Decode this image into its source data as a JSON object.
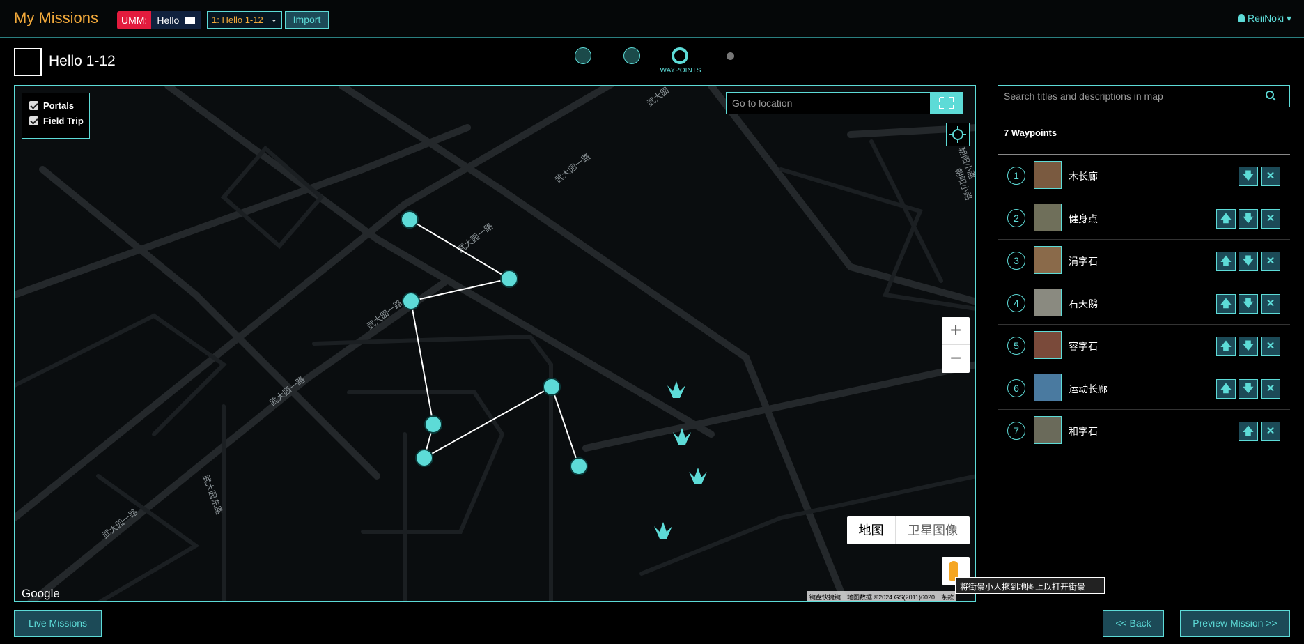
{
  "header": {
    "brand": "My Missions",
    "umm_label": "UMM:",
    "umm_project": "Hello",
    "mission_select": "1: Hello 1-12",
    "import_label": "Import",
    "user": "ReiiNoki"
  },
  "mission": {
    "title": "Hello 1-12"
  },
  "stepper": {
    "active_label": "WAYPOINTS"
  },
  "map": {
    "layers": [
      {
        "label": "Portals",
        "checked": true
      },
      {
        "label": "Field Trip",
        "checked": true
      }
    ],
    "goto_placeholder": "Go to location",
    "zoom_in": "+",
    "zoom_out": "−",
    "map_type_map": "地图",
    "map_type_satellite": "卫星图像",
    "streetview_tip": "将街景小人拖到地图上以打开街景",
    "google": "Google",
    "attribution": [
      "键盘快捷键",
      "地图数据 ©2024 GS(2011)6020",
      "条款"
    ],
    "road_labels": [
      "武大园一路",
      "武大园一路",
      "武大园一路",
      "武大园一路",
      "武大园一路",
      "武大园东路",
      "武大园",
      "朝阳小路",
      "朝阳小路"
    ]
  },
  "sidebar": {
    "search_placeholder": "Search titles and descriptions in map",
    "waypoint_count": "7 Waypoints",
    "waypoints": [
      {
        "num": "1",
        "name": "木长廊",
        "up": false,
        "down": true,
        "thumb": "#7a5a40"
      },
      {
        "num": "2",
        "name": "健身点",
        "up": true,
        "down": true,
        "thumb": "#6f6f5a"
      },
      {
        "num": "3",
        "name": "涓字石",
        "up": true,
        "down": true,
        "thumb": "#8a6a4a"
      },
      {
        "num": "4",
        "name": "石天鹅",
        "up": true,
        "down": true,
        "thumb": "#8a8a80"
      },
      {
        "num": "5",
        "name": "容字石",
        "up": true,
        "down": true,
        "thumb": "#7a4a3a"
      },
      {
        "num": "6",
        "name": "运动长廊",
        "up": true,
        "down": true,
        "thumb": "#4a7aa0"
      },
      {
        "num": "7",
        "name": "和字石",
        "up": true,
        "down": false,
        "thumb": "#6a6a5a"
      }
    ]
  },
  "footer": {
    "live_missions": "Live Missions",
    "back": "<< Back",
    "preview": "Preview Mission >>"
  },
  "colors": {
    "accent": "#5ddbd7",
    "brand": "#f2a93b",
    "umm_red": "#e31b3d"
  }
}
